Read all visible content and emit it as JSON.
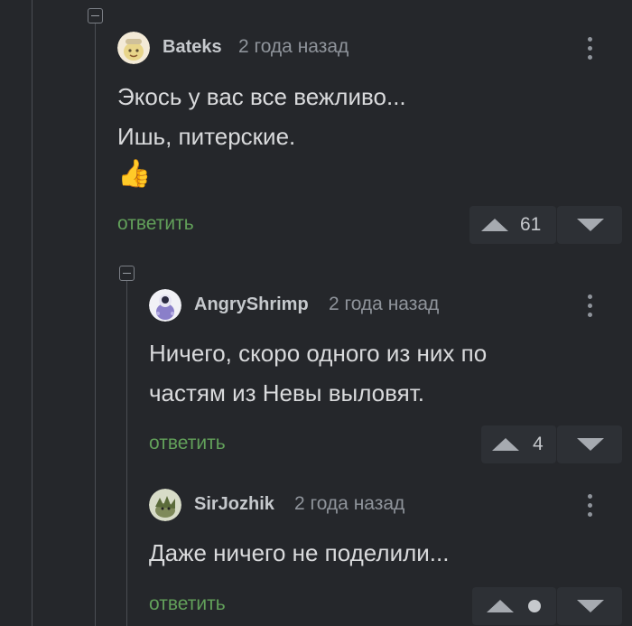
{
  "comments": [
    {
      "author": "Bateks",
      "time": "2 года назад",
      "lines": [
        "Экось у вас все вежливо...",
        "Ишь, питерские."
      ],
      "emoji": "👍",
      "reply_label": "ответить",
      "score": "61"
    },
    {
      "author": "AngryShrimp",
      "time": "2 года назад",
      "lines": [
        "Ничего, скоро одного из них по",
        "частям из Невы выловят."
      ],
      "reply_label": "ответить",
      "score": "4"
    },
    {
      "author": "SirJozhik",
      "time": "2 года назад",
      "lines": [
        "Даже ничего не поделили..."
      ],
      "reply_label": "ответить",
      "score": "•"
    }
  ],
  "colors": {
    "background": "#25272b",
    "reply_link": "#62a05a",
    "thread_line": "#4a4d53"
  }
}
